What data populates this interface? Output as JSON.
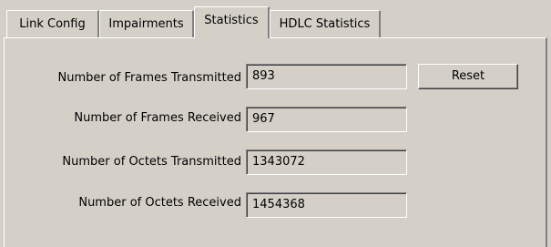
{
  "tabs": [
    {
      "label": "Link Config",
      "active": false
    },
    {
      "label": "Impairments",
      "active": false
    },
    {
      "label": "Statistics",
      "active": true
    },
    {
      "label": "HDLC Statistics",
      "active": false
    }
  ],
  "statistics": {
    "frames_transmitted": {
      "label": "Number of Frames Transmitted",
      "value": "893"
    },
    "frames_received": {
      "label": "Number of Frames Received",
      "value": "967"
    },
    "octets_transmitted": {
      "label": "Number of Octets Transmitted",
      "value": "1343072"
    },
    "octets_received": {
      "label": "Number of Octets Received",
      "value": "1454368"
    }
  },
  "buttons": {
    "reset_label": "Reset"
  },
  "colors": {
    "face": "#d4d0c8",
    "highlight": "#ffffff",
    "shadow": "#808080",
    "dark_shadow": "#404040"
  }
}
